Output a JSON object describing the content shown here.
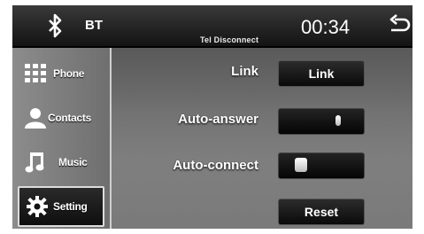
{
  "header": {
    "bt_icon": "bluetooth-icon",
    "bt_label": "BT",
    "status_text": "Tel Disconnect",
    "clock": "00:34",
    "back_icon": "back-arrow-icon"
  },
  "sidebar": {
    "items": [
      {
        "label": "Phone",
        "icon": "keypad-icon",
        "active": false
      },
      {
        "label": "Contacts",
        "icon": "contacts-icon",
        "active": false
      },
      {
        "label": "Music",
        "icon": "music-note-icon",
        "active": false
      },
      {
        "label": "Setting",
        "icon": "gear-icon",
        "active": true
      }
    ]
  },
  "settings": {
    "link": {
      "label": "Link",
      "button_label": "Link"
    },
    "auto_answer": {
      "label": "Auto-answer",
      "state": "on"
    },
    "auto_connect": {
      "label": "Auto-connect",
      "state": "off"
    },
    "reset_label": "Reset"
  }
}
